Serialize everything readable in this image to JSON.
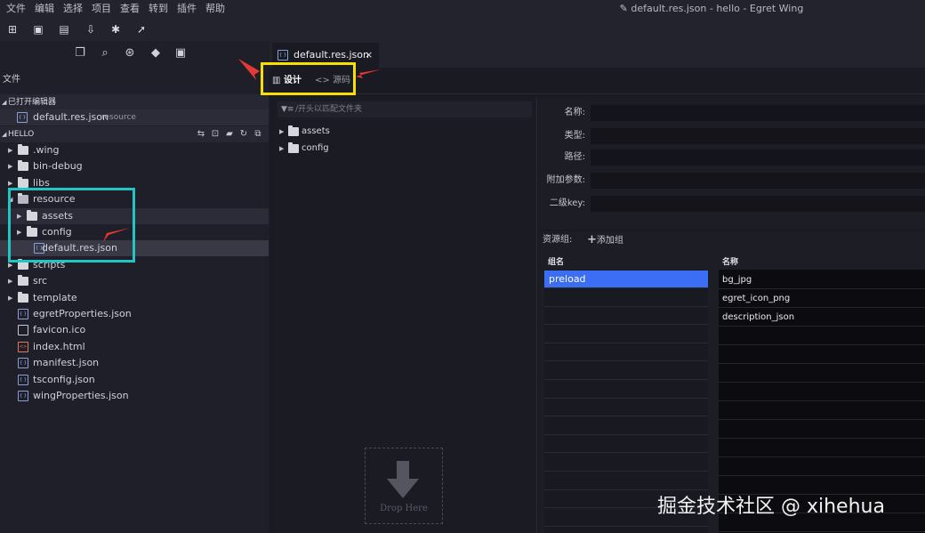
{
  "menu": [
    "文件",
    "编辑",
    "选择",
    "项目",
    "查看",
    "转到",
    "插件",
    "帮助"
  ],
  "window_title": "default.res.json - hello - Egret Wing",
  "sidebar": {
    "files_header": "文件",
    "open_editors": {
      "title": "已打开编辑器",
      "items": [
        {
          "label": "default.res.json",
          "hint": "resource"
        }
      ]
    },
    "project": {
      "title": "HELLO",
      "tree": [
        {
          "label": ".wing",
          "type": "folder",
          "level": 0
        },
        {
          "label": "bin-debug",
          "type": "folder",
          "level": 0
        },
        {
          "label": "libs",
          "type": "folder",
          "level": 0
        },
        {
          "label": "resource",
          "type": "folder-open",
          "level": 0
        },
        {
          "label": "assets",
          "type": "folder",
          "level": 1
        },
        {
          "label": "config",
          "type": "folder",
          "level": 1
        },
        {
          "label": "default.res.json",
          "type": "json",
          "level": 1
        },
        {
          "label": "scripts",
          "type": "folder",
          "level": 0
        },
        {
          "label": "src",
          "type": "folder",
          "level": 0
        },
        {
          "label": "template",
          "type": "folder",
          "level": 0
        },
        {
          "label": "egretProperties.json",
          "type": "json",
          "level": 0
        },
        {
          "label": "favicon.ico",
          "type": "ico",
          "level": 0
        },
        {
          "label": "index.html",
          "type": "html",
          "level": 0
        },
        {
          "label": "manifest.json",
          "type": "json",
          "level": 0
        },
        {
          "label": "tsconfig.json",
          "type": "json",
          "level": 0
        },
        {
          "label": "wingProperties.json",
          "type": "json",
          "level": 0
        }
      ]
    }
  },
  "editor": {
    "tab": {
      "label": "default.res.json",
      "close": "×"
    },
    "modes": {
      "design": "设计",
      "source": "源码",
      "design_icon": "▥",
      "source_icon": "<>"
    },
    "filter_placeholder": "/开头以匹配文件夹",
    "folders": [
      "assets",
      "config"
    ],
    "properties": [
      {
        "label": "名称:"
      },
      {
        "label": "类型:"
      },
      {
        "label": "路径:"
      },
      {
        "label": "附加参数:"
      },
      {
        "label": "二级key:"
      }
    ],
    "resource_groups": {
      "title": "资源组:",
      "add": "添加组",
      "group_col": "组名",
      "name_col": "名称",
      "groups": [
        "preload"
      ],
      "items": [
        "bg_jpg",
        "egret_icon_png",
        "description_json"
      ]
    },
    "drop_here": "Drop Here"
  },
  "watermark": "掘金技术社区 @ xihehua",
  "colors": {
    "selection": "#3b6ef5",
    "annotation_yellow": "#f5e000",
    "annotation_cyan": "#23c4c4",
    "arrow_red": "#e53935"
  }
}
